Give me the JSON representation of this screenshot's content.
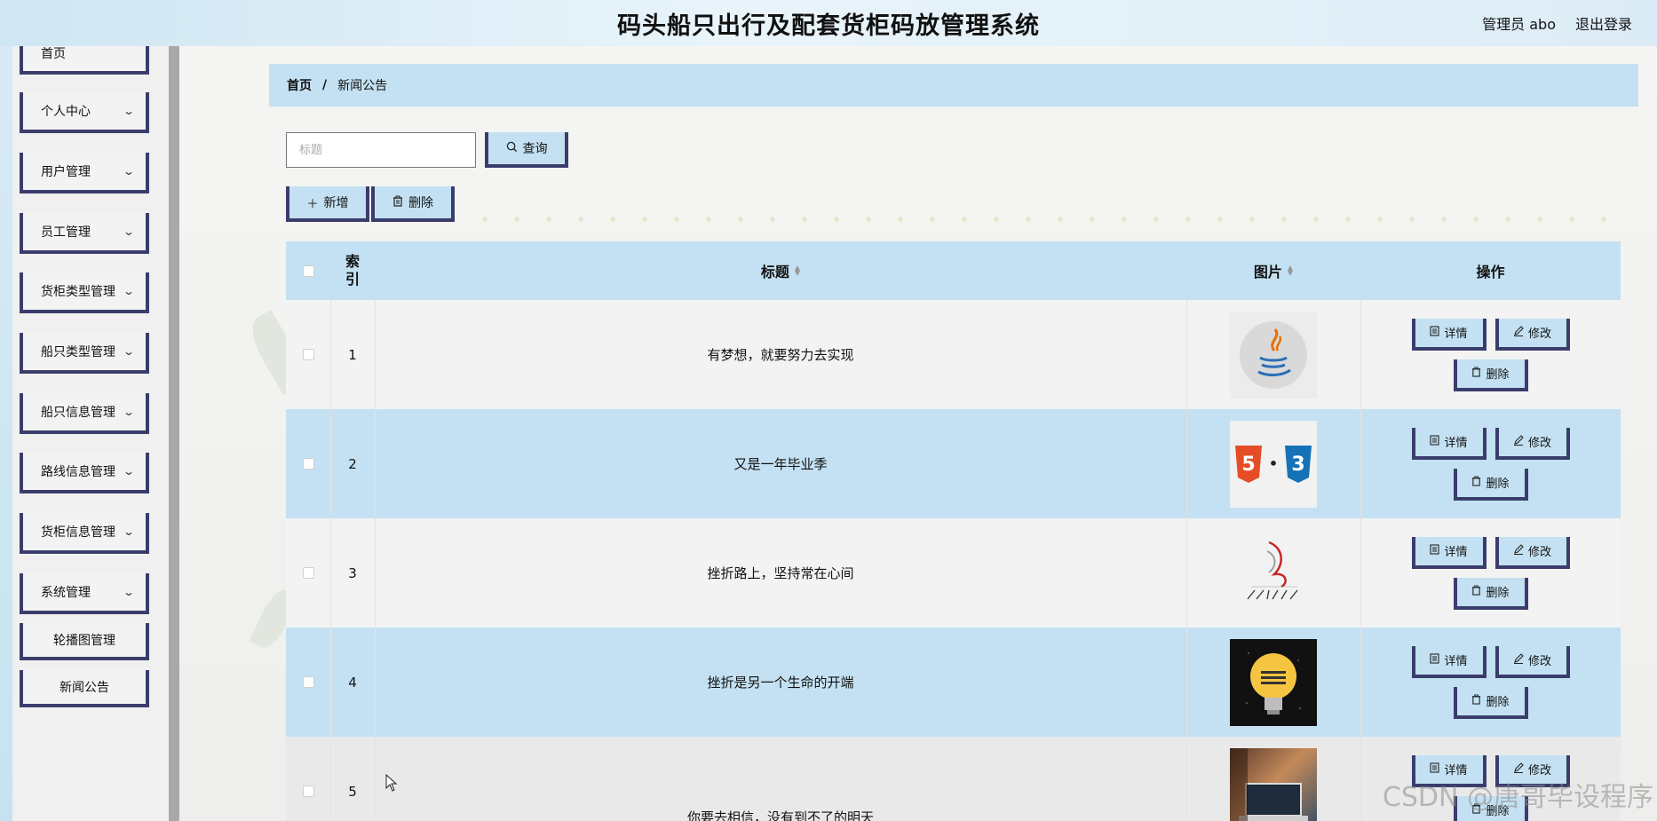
{
  "header": {
    "title": "码头船只出行及配套货柜码放管理系统",
    "user": "管理员 abo",
    "logout": "退出登录"
  },
  "sidebar": {
    "items": [
      {
        "label": "首页",
        "chevron": false
      },
      {
        "label": "个人中心",
        "chevron": true
      },
      {
        "label": "用户管理",
        "chevron": true
      },
      {
        "label": "员工管理",
        "chevron": true
      },
      {
        "label": "货柜类型管理",
        "chevron": true
      },
      {
        "label": "船只类型管理",
        "chevron": true
      },
      {
        "label": "船只信息管理",
        "chevron": true
      },
      {
        "label": "路线信息管理",
        "chevron": true
      },
      {
        "label": "货柜信息管理",
        "chevron": true
      },
      {
        "label": "系统管理",
        "chevron": true
      }
    ],
    "sub_items": [
      {
        "label": "轮播图管理"
      },
      {
        "label": "新闻公告"
      }
    ]
  },
  "breadcrumb": {
    "home": "首页",
    "separator": "/",
    "current": "新闻公告"
  },
  "search": {
    "placeholder": "标题",
    "value": "",
    "button": "查询"
  },
  "toolbar": {
    "add": "新增",
    "delete": "删除"
  },
  "table": {
    "headers": {
      "index": "索引",
      "title": "标题",
      "image": "图片",
      "actions": "操作"
    },
    "rows": [
      {
        "index": "1",
        "title": "有梦想，就要努力去实现",
        "image": "java-logo"
      },
      {
        "index": "2",
        "title": "又是一年毕业季",
        "image": "html5-css3-logo"
      },
      {
        "index": "3",
        "title": "挫折路上，坚持常在心间",
        "image": "sql-server-2012-logo"
      },
      {
        "index": "4",
        "title": "挫折是另一个生命的开端",
        "image": "lightbulb-poster"
      },
      {
        "index": "5",
        "title": "你要去相信，没有到不了的明天",
        "image": "laptop-photo"
      }
    ],
    "row_actions": {
      "detail": "详情",
      "edit": "修改",
      "delete": "删除"
    }
  },
  "watermark": "CSDN @唐哥毕设程序",
  "colors": {
    "accent_light_blue": "#c3e1f2",
    "border_navy": "#3a3d6c",
    "sidebar_bg": "#f0f0f0"
  }
}
